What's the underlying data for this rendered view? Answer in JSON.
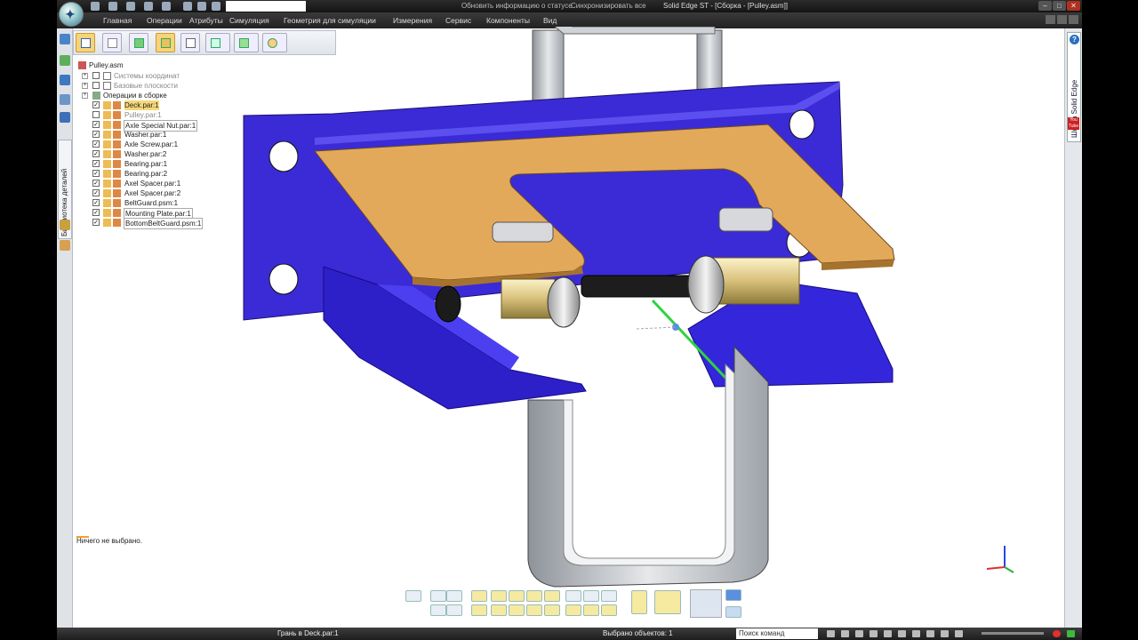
{
  "window": {
    "title": "Solid Edge ST - [Сборка - [Pulley.asm]]",
    "status_hint": "Обновить информацию о статусе",
    "sync_label": "Синхронизировать все",
    "title_segments": [
      "Solid Edge ST",
      "Сборка",
      "[Pulley.asm]"
    ]
  },
  "menu": {
    "items": [
      "Главная",
      "Операции",
      "Атрибуты",
      "Симуляция",
      "Геометрия для симуляции",
      "Измерения",
      "Сервис",
      "Компоненты",
      "Вид"
    ]
  },
  "toolbar": {
    "buttons": [
      "select-tool-icon",
      "copy-part-icon",
      "add-part-icon",
      "assemble-icon",
      "list-icon",
      "relationship-icon",
      "pattern-icon",
      "motor-icon"
    ]
  },
  "left_panel": {
    "library_tab": "Библиотека деталей"
  },
  "tree": {
    "root": "Pulley.asm",
    "groups": [
      {
        "label": "Системы координат"
      },
      {
        "label": "Базовые плоскости"
      },
      {
        "label": "Операции в сборке"
      }
    ],
    "parts": [
      {
        "label": "Deck.par:1",
        "state": "selected"
      },
      {
        "label": "Pulley.par:1",
        "state": "dim"
      },
      {
        "label": "Axle Special Nut.par:1",
        "state": "boxed"
      },
      {
        "label": "Washer.par:1",
        "state": "normal"
      },
      {
        "label": "Axle Screw.par:1",
        "state": "normal"
      },
      {
        "label": "Washer.par:2",
        "state": "normal"
      },
      {
        "label": "Bearing.par:1",
        "state": "normal"
      },
      {
        "label": "Bearing.par:2",
        "state": "normal"
      },
      {
        "label": "Axel Spacer.par:1",
        "state": "normal"
      },
      {
        "label": "Axel Spacer.par:2",
        "state": "normal"
      },
      {
        "label": "BeltGuard.psm:1",
        "state": "normal"
      },
      {
        "label": "Mounting Plate.par:1",
        "state": "boxed"
      },
      {
        "label": "BottomBeltGuard.psm:1",
        "state": "boxed"
      }
    ]
  },
  "message": "Ничего не выбрано.",
  "right_panel": {
    "school_tab": "Школа Solid Edge",
    "help": "?",
    "youtube": "You Tube"
  },
  "status_bar": {
    "left": "Грань в Deck.par:1",
    "middle": "Выбрано объектов: 1",
    "command_search": "Поиск команд"
  },
  "colors": {
    "mounting_plate": "#3a2bd6",
    "deck": "#e3a95a",
    "belt_guard": "#b9bdc3",
    "bearing_spacer": "#e8d49a",
    "highlight_edge": "#2fd23f"
  }
}
